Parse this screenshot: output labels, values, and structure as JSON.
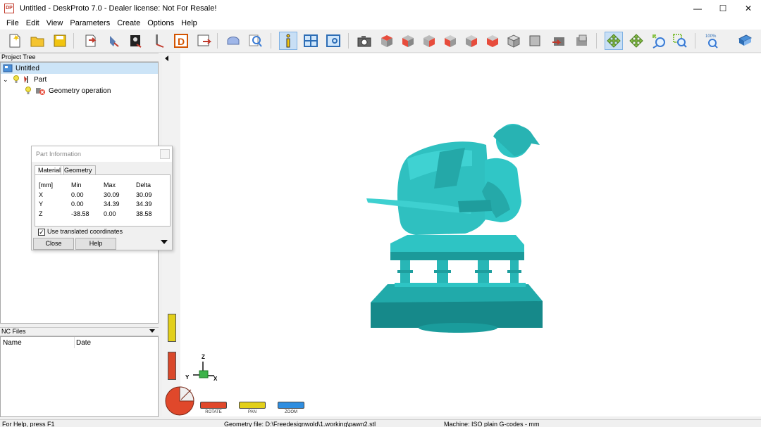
{
  "window": {
    "title": "Untitled - DeskProto 7.0 - Dealer license: Not For Resale!",
    "app_icon_label": "DP",
    "minimize": "—",
    "maximize": "☐",
    "close": "✕"
  },
  "menu": [
    "File",
    "Edit",
    "View",
    "Parameters",
    "Create",
    "Options",
    "Help"
  ],
  "toolbar": {
    "zoom_label": "100%"
  },
  "project_tree": {
    "header": "Project Tree",
    "items": [
      {
        "label": "Untitled"
      },
      {
        "label": "Part"
      },
      {
        "label": "Geometry operation"
      }
    ]
  },
  "nc_files": {
    "header": "NC Files",
    "columns": [
      "Name",
      "Date"
    ]
  },
  "part_info": {
    "title": "Part Information",
    "tabs": [
      "Material",
      "Geometry"
    ],
    "header": [
      "[mm]",
      "Min",
      "Max",
      "Delta"
    ],
    "rows": [
      [
        "X",
        "0.00",
        "30.09",
        "30.09"
      ],
      [
        "Y",
        "0.00",
        "34.39",
        "34.39"
      ],
      [
        "Z",
        "-38.58",
        "0.00",
        "38.58"
      ]
    ],
    "checkbox_label": "Use translated coordinates",
    "checked": true,
    "close_button": "Close",
    "help_button": "Help"
  },
  "axes": {
    "z": "Z",
    "y": "Y",
    "x": "X"
  },
  "view_modes": [
    {
      "label": "ROTATE",
      "color": "#e0482b"
    },
    {
      "label": "PAN",
      "color": "#e2cf1a"
    },
    {
      "label": "ZOOM",
      "color": "#2f8ee0"
    }
  ],
  "status": {
    "help": "For Help, press F1",
    "geometry": "Geometry file: D:\\Freedesignwold\\1.working\\pawn2.stl",
    "machine": "Machine: ISO plain G-codes - mm"
  },
  "colors": {
    "model": "#2ec4c4",
    "accent": "#c0392b",
    "selection": "#cce4f7"
  }
}
